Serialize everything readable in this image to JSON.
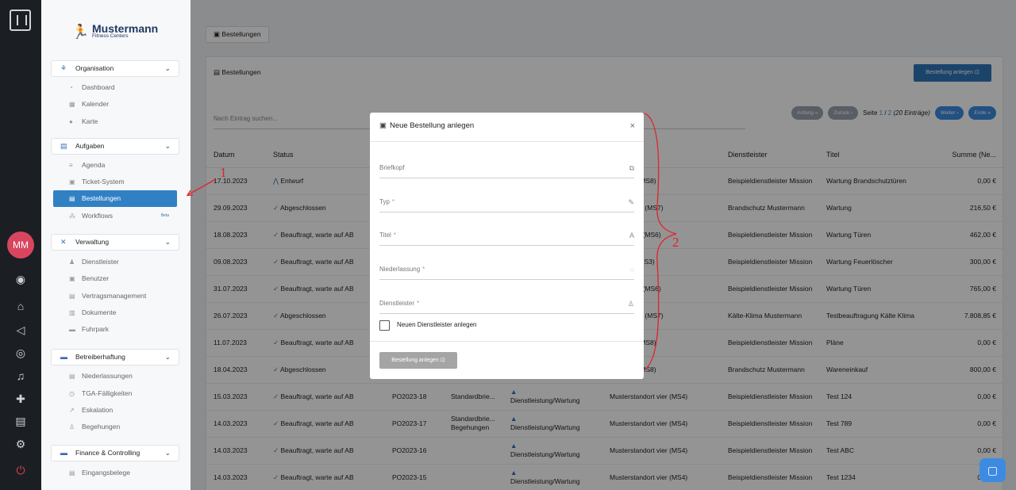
{
  "rail": {
    "avatar_initials": "MM"
  },
  "brand": {
    "name": "Mustermann",
    "sub": "Fitness Centers"
  },
  "sidebar": {
    "sections": [
      {
        "label": "Organisation",
        "items": [
          "Dashboard",
          "Kalender",
          "Karte"
        ]
      },
      {
        "label": "Aufgaben",
        "items": [
          "Agenda",
          "Ticket-System",
          "Bestellungen",
          "Workflows"
        ]
      },
      {
        "label": "Verwaltung",
        "items": [
          "Dienstleister",
          "Benutzer",
          "Vertragsmanagement",
          "Dokumente",
          "Fuhrpark"
        ]
      },
      {
        "label": "Betreiberhaftung",
        "items": [
          "Niederlassungen",
          "TGA-Fälligkeiten",
          "Eskalation",
          "Begehungen"
        ]
      },
      {
        "label": "Finance & Controlling",
        "items": [
          "Eingangsbelege"
        ]
      }
    ],
    "beta_label": "Beta"
  },
  "main": {
    "tab_label": "Bestellungen",
    "card_title": "Bestellungen",
    "new_button": "Bestellung anlegen",
    "search_placeholder": "Nach Eintrag suchen...",
    "pager": {
      "first": "Anfang",
      "prev": "Zurück",
      "page_prefix": "Seite",
      "current": "1",
      "sep": "/",
      "total": "2",
      "entries": "(20 Einträge)",
      "next": "Weiter",
      "last": "Ende"
    },
    "columns": [
      "Datum",
      "Status",
      "",
      "",
      "",
      "…ung",
      "Dienstleister",
      "Titel",
      "Summe (Ne..."
    ],
    "rows": [
      {
        "date": "17.10.2023",
        "status": "Entwurf",
        "kind": "draft",
        "po": "",
        "std": "",
        "typ": "",
        "ort": "dort acht (MS8)",
        "dl": "Beispieldienstleister Mission",
        "title": "Wartung Brandschutztüren",
        "sum": "0,00 €"
      },
      {
        "date": "29.09.2023",
        "status": "Abgeschlossen",
        "kind": "ok",
        "po": "",
        "std": "",
        "typ": "",
        "ort": "dort sieben (MS7)",
        "dl": "Brandschutz Mustermann",
        "title": "Wartung",
        "sum": "216,50 €"
      },
      {
        "date": "18.08.2023",
        "status": "Beauftragt, warte auf AB",
        "kind": "ok",
        "po": "",
        "std": "",
        "typ": "",
        "ort": "dort sechs (MS6)",
        "dl": "Beispieldienstleister Mission",
        "title": "Wartung Türen",
        "sum": "462,00 €"
      },
      {
        "date": "09.08.2023",
        "status": "Beauftragt, warte auf AB",
        "kind": "ok",
        "po": "",
        "std": "",
        "typ": "",
        "ort": "dort drei (MS3)",
        "dl": "Beispieldienstleister Mission",
        "title": "Wartung Feuerlöscher",
        "sum": "300,00 €"
      },
      {
        "date": "31.07.2023",
        "status": "Beauftragt, warte auf AB",
        "kind": "ok",
        "po": "",
        "std": "",
        "typ": "",
        "ort": "dort sechs (MS6)",
        "dl": "Beispieldienstleister Mission",
        "title": "Wartung Türen",
        "sum": "765,00 €"
      },
      {
        "date": "26.07.2023",
        "status": "Abgeschlossen",
        "kind": "ok",
        "po": "",
        "std": "",
        "typ": "",
        "ort": "dort sieben (MS7)",
        "dl": "Kälte-Klima Mustermann",
        "title": "Testbeauftragung Kälte Klima",
        "sum": "7.808,85 €"
      },
      {
        "date": "11.07.2023",
        "status": "Beauftragt, warte auf AB",
        "kind": "ok",
        "po": "",
        "std": "",
        "typ": "",
        "ort": "dort acht (MS8)",
        "dl": "Beispieldienstleister Mission",
        "title": "Pläne",
        "sum": "0,00 €"
      },
      {
        "date": "18.04.2023",
        "status": "Abgeschlossen",
        "kind": "ok",
        "po": "",
        "std": "",
        "typ": "",
        "ort": "dort acht (MS8)",
        "dl": "Brandschutz Mustermann",
        "title": "Wareneinkauf",
        "sum": "800,00 €"
      },
      {
        "date": "15.03.2023",
        "status": "Beauftragt, warte auf AB",
        "kind": "ok",
        "po": "PO2023-18",
        "std": "Standardbrie...",
        "typ": "Dienstleistung/Wartung",
        "ort": "Musterstandort vier (MS4)",
        "dl": "Beispieldienstleister Mission",
        "title": "Test 124",
        "sum": "0,00 €"
      },
      {
        "date": "14.03.2023",
        "status": "Beauftragt, warte auf AB",
        "kind": "ok",
        "po": "PO2023-17",
        "std": "Standardbrie... Begehungen",
        "typ": "Dienstleistung/Wartung",
        "ort": "Musterstandort vier (MS4)",
        "dl": "Beispieldienstleister Mission",
        "title": "Test 789",
        "sum": "0,00 €"
      },
      {
        "date": "14.03.2023",
        "status": "Beauftragt, warte auf AB",
        "kind": "ok",
        "po": "PO2023-16",
        "std": "",
        "typ": "Dienstleistung/Wartung",
        "ort": "Musterstandort vier (MS4)",
        "dl": "Beispieldienstleister Mission",
        "title": "Test ABC",
        "sum": "0,00 €"
      },
      {
        "date": "14.03.2023",
        "status": "Beauftragt, warte auf AB",
        "kind": "ok",
        "po": "PO2023-15",
        "std": "",
        "typ": "Dienstleistung/Wartung",
        "ort": "Musterstandort vier (MS4)",
        "dl": "Beispieldienstleister Mission",
        "title": "Test 1234",
        "sum": "0,00 €"
      }
    ]
  },
  "modal": {
    "title": "Neue Bestellung anlegen",
    "fields": [
      {
        "label": "Briefkopf",
        "required": ""
      },
      {
        "label": "Typ",
        "required": "*"
      },
      {
        "label": "Titel",
        "required": "*"
      },
      {
        "label": "Niederlassung",
        "required": "*"
      },
      {
        "label": "Dienstleister",
        "required": "*"
      }
    ],
    "checkbox_label": "Neuen Dienstleister anlegen",
    "submit": "Bestellung anlegen"
  },
  "annotations": {
    "one": "1",
    "two": "2"
  },
  "colors": {
    "accent": "#3280c4",
    "ok": "#2a9d52",
    "annotation": "#e0232a",
    "avatar": "#d9455f"
  }
}
